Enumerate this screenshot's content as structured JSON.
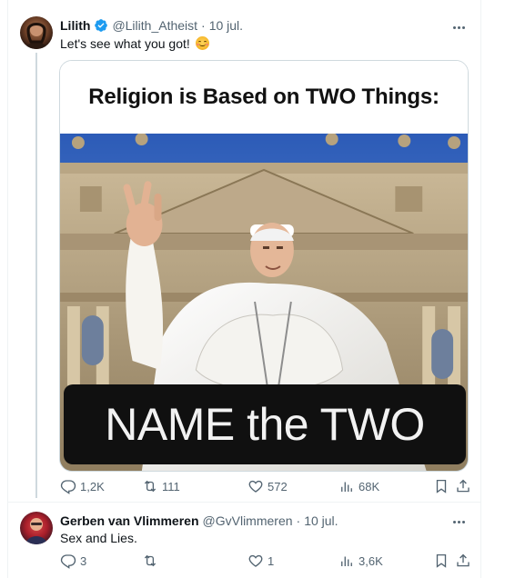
{
  "tweets": [
    {
      "author": {
        "display_name": "Lilith",
        "handle": "@Lilith_Atheist",
        "verified": true,
        "avatar_icon": "avatar-photo"
      },
      "separator": "·",
      "date": "10 jul.",
      "text": "Let's see what you got!",
      "emoji": "smiling-face-with-smiling-eyes",
      "media": {
        "title_text": "Religion is Based on TWO Things:",
        "caption_text": "NAME the TWO"
      },
      "stats": {
        "replies": "1,2K",
        "reposts": "111",
        "likes": "572",
        "views": "68K"
      }
    },
    {
      "author": {
        "display_name": "Gerben van Vlimmeren",
        "handle": "@GvVlimmeren",
        "verified": false,
        "avatar_icon": "avatar-photo"
      },
      "separator": "·",
      "date": "10 jul.",
      "text": "Sex and Lies.",
      "stats": {
        "replies": "3",
        "reposts": "",
        "likes": "1",
        "views": "3,6K"
      }
    }
  ],
  "colors": {
    "verified_blue": "#1d9bf0",
    "secondary_text": "#536471",
    "primary_text": "#0f1419",
    "border": "#cfd9de"
  }
}
